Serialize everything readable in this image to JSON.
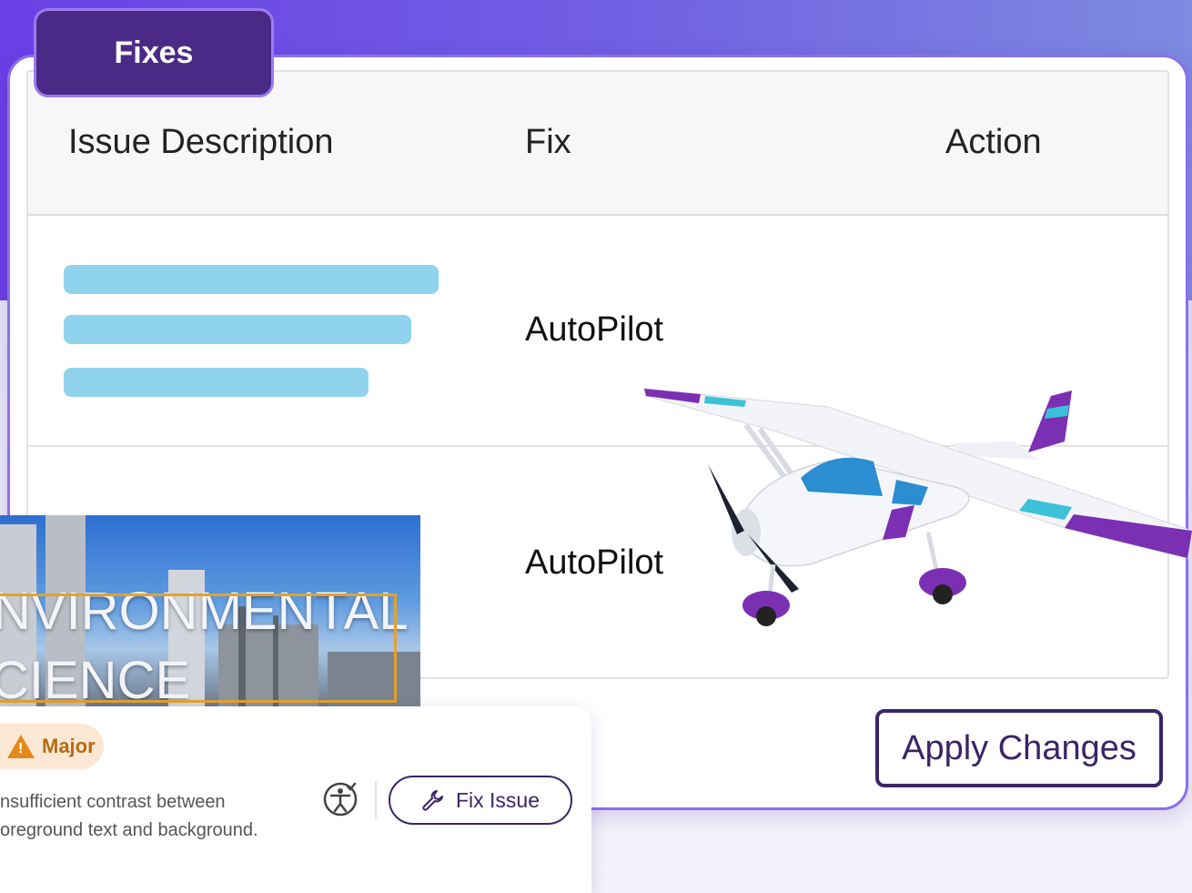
{
  "panel": {
    "tab_label": "Fixes"
  },
  "table": {
    "columns": [
      "Issue Description",
      "Fix",
      "Action"
    ],
    "rows": [
      {
        "fix": "AutoPilot"
      },
      {
        "fix": "AutoPilot"
      }
    ],
    "apply_label": "Apply Changes"
  },
  "thumbnail": {
    "line1": "NVIRONMENTAL",
    "line2": "CIENCE"
  },
  "issue_card": {
    "severity": "Major",
    "description_line1": "nsufficient contrast between",
    "description_line2": "oreground text and background.",
    "fix_button_label": "Fix Issue",
    "severity_color": "#e38a1c"
  },
  "colors": {
    "tab_bg": "#4a2a86",
    "bar": "#8fd3ec",
    "button_border": "#3a2567",
    "plane_accent": "#7b2fb3"
  }
}
